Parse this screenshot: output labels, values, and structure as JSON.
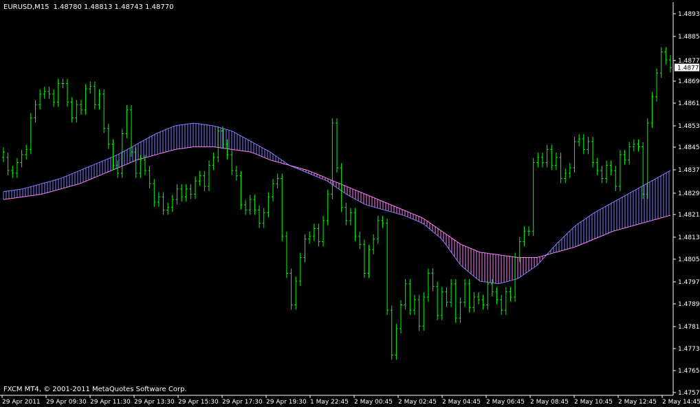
{
  "window": {
    "title": "EURUSD,M15",
    "ohlc": "1.48780 1.48813 1.48743 1.48770",
    "footer": "FXCM MT4, © 2001-2011 MetaQuotes Software Corp."
  },
  "chart_data": {
    "type": "bar",
    "symbol": "EURUSD",
    "timeframe": "M15",
    "grid": false,
    "background": "#000000",
    "colors": {
      "bars": "#00ff00",
      "ma_fast": "#8080ff",
      "ma_slow": "#ff80ff",
      "band_up": "#8080ff",
      "band_down": "#ff80ff",
      "axis": "#ffffff",
      "current_price_box": "#ffffff"
    },
    "current_price": "1.48770",
    "ylim": [
      1.4754,
      1.48975
    ],
    "y_ticks": [
      "1.48935",
      "1.48855",
      "1.48770",
      "1.48695",
      "1.48615",
      "1.48535",
      "1.48455",
      "1.48375",
      "1.48295",
      "1.48215",
      "1.48135",
      "1.48055",
      "1.47975",
      "1.47895",
      "1.47815",
      "1.47735",
      "1.47655",
      "1.47575"
    ],
    "x_ticks": [
      "29 Apr 2011",
      "29 Apr 09:30",
      "29 Apr 11:30",
      "29 Apr 13:30",
      "29 Apr 15:30",
      "29 Apr 17:30",
      "29 Apr 19:30",
      "1 May 22:45",
      "2 May 00:45",
      "2 May 02:45",
      "2 May 04:45",
      "2 May 06:45",
      "2 May 08:45",
      "2 May 10:45",
      "2 May 12:45",
      "2 May 14:45"
    ],
    "bars": [
      [
        1.4843,
        1.4845
      ],
      [
        1.4843,
        1.4838
      ],
      [
        1.4838,
        1.4837
      ],
      [
        1.4837,
        1.4841
      ],
      [
        1.4841,
        1.4844
      ],
      [
        1.4844,
        1.4846
      ],
      [
        1.4846,
        1.4858
      ],
      [
        1.4858,
        1.4863
      ],
      [
        1.4863,
        1.4867
      ],
      [
        1.4867,
        1.4868
      ],
      [
        1.4868,
        1.4867
      ],
      [
        1.4867,
        1.4864
      ],
      [
        1.4864,
        1.4871
      ],
      [
        1.4871,
        1.4871
      ],
      [
        1.4871,
        1.4864
      ],
      [
        1.4864,
        1.4858
      ],
      [
        1.4858,
        1.4863
      ],
      [
        1.4863,
        1.4861
      ],
      [
        1.4861,
        1.4869
      ],
      [
        1.4869,
        1.487
      ],
      [
        1.487,
        1.4863
      ],
      [
        1.4863,
        1.4867
      ],
      [
        1.4867,
        1.4854
      ],
      [
        1.4854,
        1.4848
      ],
      [
        1.4848,
        1.484
      ],
      [
        1.484,
        1.4837
      ],
      [
        1.4837,
        1.4852
      ],
      [
        1.4852,
        1.4861
      ],
      [
        1.4861,
        1.4845
      ],
      [
        1.4845,
        1.4837
      ],
      [
        1.4837,
        1.4842
      ],
      [
        1.4842,
        1.4838
      ],
      [
        1.4838,
        1.4833
      ],
      [
        1.4833,
        1.4826
      ],
      [
        1.4826,
        1.4828
      ],
      [
        1.4828,
        1.4823
      ],
      [
        1.4823,
        1.4824
      ],
      [
        1.4824,
        1.4827
      ],
      [
        1.4827,
        1.4831
      ],
      [
        1.4831,
        1.4828
      ],
      [
        1.4828,
        1.4831
      ],
      [
        1.4831,
        1.4829
      ],
      [
        1.4829,
        1.4834
      ],
      [
        1.4834,
        1.4836
      ],
      [
        1.4836,
        1.4832
      ],
      [
        1.4832,
        1.484
      ],
      [
        1.484,
        1.4843
      ],
      [
        1.4843,
        1.4853
      ],
      [
        1.4853,
        1.4848
      ],
      [
        1.4848,
        1.4844
      ],
      [
        1.4844,
        1.4838
      ],
      [
        1.4838,
        1.4836
      ],
      [
        1.4836,
        1.4825
      ],
      [
        1.4825,
        1.4823
      ],
      [
        1.4823,
        1.4827
      ],
      [
        1.4827,
        1.4823
      ],
      [
        1.4823,
        1.4818
      ],
      [
        1.4818,
        1.4822
      ],
      [
        1.4822,
        1.4828
      ],
      [
        1.4828,
        1.4833
      ],
      [
        1.4833,
        1.4835
      ],
      [
        1.4835,
        1.4813
      ],
      [
        1.4813,
        1.4799
      ],
      [
        1.4799,
        1.4787
      ],
      [
        1.4787,
        1.4796
      ],
      [
        1.4796,
        1.4805
      ],
      [
        1.4805,
        1.4812
      ],
      [
        1.4812,
        1.4813
      ],
      [
        1.4813,
        1.4816
      ],
      [
        1.4816,
        1.4811
      ],
      [
        1.4811,
        1.4819
      ],
      [
        1.4819,
        1.4829
      ],
      [
        1.4829,
        1.4856
      ],
      [
        1.4856,
        1.4839
      ],
      [
        1.4839,
        1.4824
      ],
      [
        1.4824,
        1.4819
      ],
      [
        1.4819,
        1.4822
      ],
      [
        1.4822,
        1.4813
      ],
      [
        1.4813,
        1.481
      ],
      [
        1.481,
        1.4799
      ],
      [
        1.4799,
        1.4808
      ],
      [
        1.4808,
        1.4812
      ],
      [
        1.4812,
        1.4819
      ],
      [
        1.4819,
        1.4818
      ],
      [
        1.4818,
        1.4785
      ],
      [
        1.4785,
        1.4768
      ],
      [
        1.4768,
        1.4778
      ],
      [
        1.4778,
        1.4787
      ],
      [
        1.4787,
        1.4795
      ],
      [
        1.4795,
        1.4785
      ],
      [
        1.4785,
        1.4789
      ],
      [
        1.4789,
        1.4779
      ],
      [
        1.4779,
        1.479
      ],
      [
        1.479,
        1.4799
      ],
      [
        1.4799,
        1.4794
      ],
      [
        1.4794,
        1.4783
      ],
      [
        1.4783,
        1.4792
      ],
      [
        1.4792,
        1.4788
      ],
      [
        1.4788,
        1.4795
      ],
      [
        1.4795,
        1.4782
      ],
      [
        1.4782,
        1.4788
      ],
      [
        1.4788,
        1.4795
      ],
      [
        1.4795,
        1.4786
      ],
      [
        1.4786,
        1.479
      ],
      [
        1.479,
        1.4789
      ],
      [
        1.4789,
        1.4787
      ],
      [
        1.4787,
        1.4795
      ],
      [
        1.4795,
        1.4792
      ],
      [
        1.4792,
        1.4789
      ],
      [
        1.4789,
        1.4785
      ],
      [
        1.4785,
        1.4792
      ],
      [
        1.4792,
        1.479
      ],
      [
        1.479,
        1.4805
      ],
      [
        1.4805,
        1.4811
      ],
      [
        1.4811,
        1.4815
      ],
      [
        1.4815,
        1.4815
      ],
      [
        1.4815,
        1.4841
      ],
      [
        1.4841,
        1.4843
      ],
      [
        1.4843,
        1.4841
      ],
      [
        1.4841,
        1.4846
      ],
      [
        1.4846,
        1.484
      ],
      [
        1.484,
        1.4843
      ],
      [
        1.4843,
        1.4835
      ],
      [
        1.4835,
        1.4837
      ],
      [
        1.4837,
        1.4839
      ],
      [
        1.4839,
        1.4849
      ],
      [
        1.4849,
        1.485
      ],
      [
        1.485,
        1.4846
      ],
      [
        1.4846,
        1.4849
      ],
      [
        1.4849,
        1.4841
      ],
      [
        1.4841,
        1.4838
      ],
      [
        1.4838,
        1.4835
      ],
      [
        1.4835,
        1.484
      ],
      [
        1.484,
        1.4838
      ],
      [
        1.4838,
        1.4832
      ],
      [
        1.4832,
        1.4844
      ],
      [
        1.4844,
        1.4842
      ],
      [
        1.4842,
        1.4847
      ],
      [
        1.4847,
        1.4848
      ],
      [
        1.4848,
        1.4847
      ],
      [
        1.4847,
        1.4829
      ],
      [
        1.4829,
        1.4856
      ],
      [
        1.4856,
        1.4866
      ],
      [
        1.4866,
        1.4875
      ],
      [
        1.4875,
        1.4883
      ],
      [
        1.4883,
        1.488
      ],
      [
        1.488,
        1.4877
      ]
    ],
    "ma_fast_series": [
      1.483,
      1.4831,
      1.4833,
      1.4835,
      1.4838,
      1.4841,
      1.4844,
      1.4848,
      1.4852,
      1.4855,
      1.4856,
      1.4855,
      1.4853,
      1.4849,
      1.4845,
      1.484,
      1.4837,
      1.4834,
      1.4829,
      1.4825,
      1.4823,
      1.4821,
      1.4818,
      1.4812,
      1.4802,
      1.4796,
      1.4795,
      1.4797,
      1.4802,
      1.481,
      1.4817,
      1.4822,
      1.4826,
      1.483,
      1.4834,
      1.4838
    ],
    "ma_slow_series": [
      1.4827,
      1.4828,
      1.4829,
      1.4831,
      1.4833,
      1.4836,
      1.4839,
      1.4842,
      1.4844,
      1.4846,
      1.4847,
      1.4847,
      1.4846,
      1.4845,
      1.4842,
      1.484,
      1.4838,
      1.4835,
      1.4832,
      1.4829,
      1.4826,
      1.4823,
      1.482,
      1.4815,
      1.481,
      1.4807,
      1.4806,
      1.4805,
      1.4805,
      1.4807,
      1.4809,
      1.4812,
      1.4815,
      1.4817,
      1.4819,
      1.4821
    ]
  }
}
